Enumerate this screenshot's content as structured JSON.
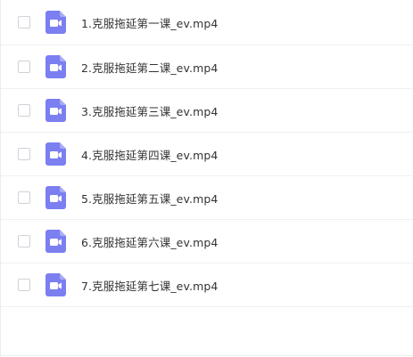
{
  "colors": {
    "video_icon_bg": "#7b7ff0",
    "video_icon_fold": "#a9acf6",
    "video_icon_glyph": "#ffffff",
    "text": "#333333",
    "divider": "#f0f0f0"
  },
  "files": [
    {
      "name": "1.克服拖延第一课_ev.mp4",
      "icon": "video-file-icon"
    },
    {
      "name": "2.克服拖延第二课_ev.mp4",
      "icon": "video-file-icon"
    },
    {
      "name": "3.克服拖延第三课_ev.mp4",
      "icon": "video-file-icon"
    },
    {
      "name": "4.克服拖延第四课_ev.mp4",
      "icon": "video-file-icon"
    },
    {
      "name": "5.克服拖延第五课_ev.mp4",
      "icon": "video-file-icon"
    },
    {
      "name": "6.克服拖延第六课_ev.mp4",
      "icon": "video-file-icon"
    },
    {
      "name": "7.克服拖延第七课_ev.mp4",
      "icon": "video-file-icon"
    }
  ]
}
